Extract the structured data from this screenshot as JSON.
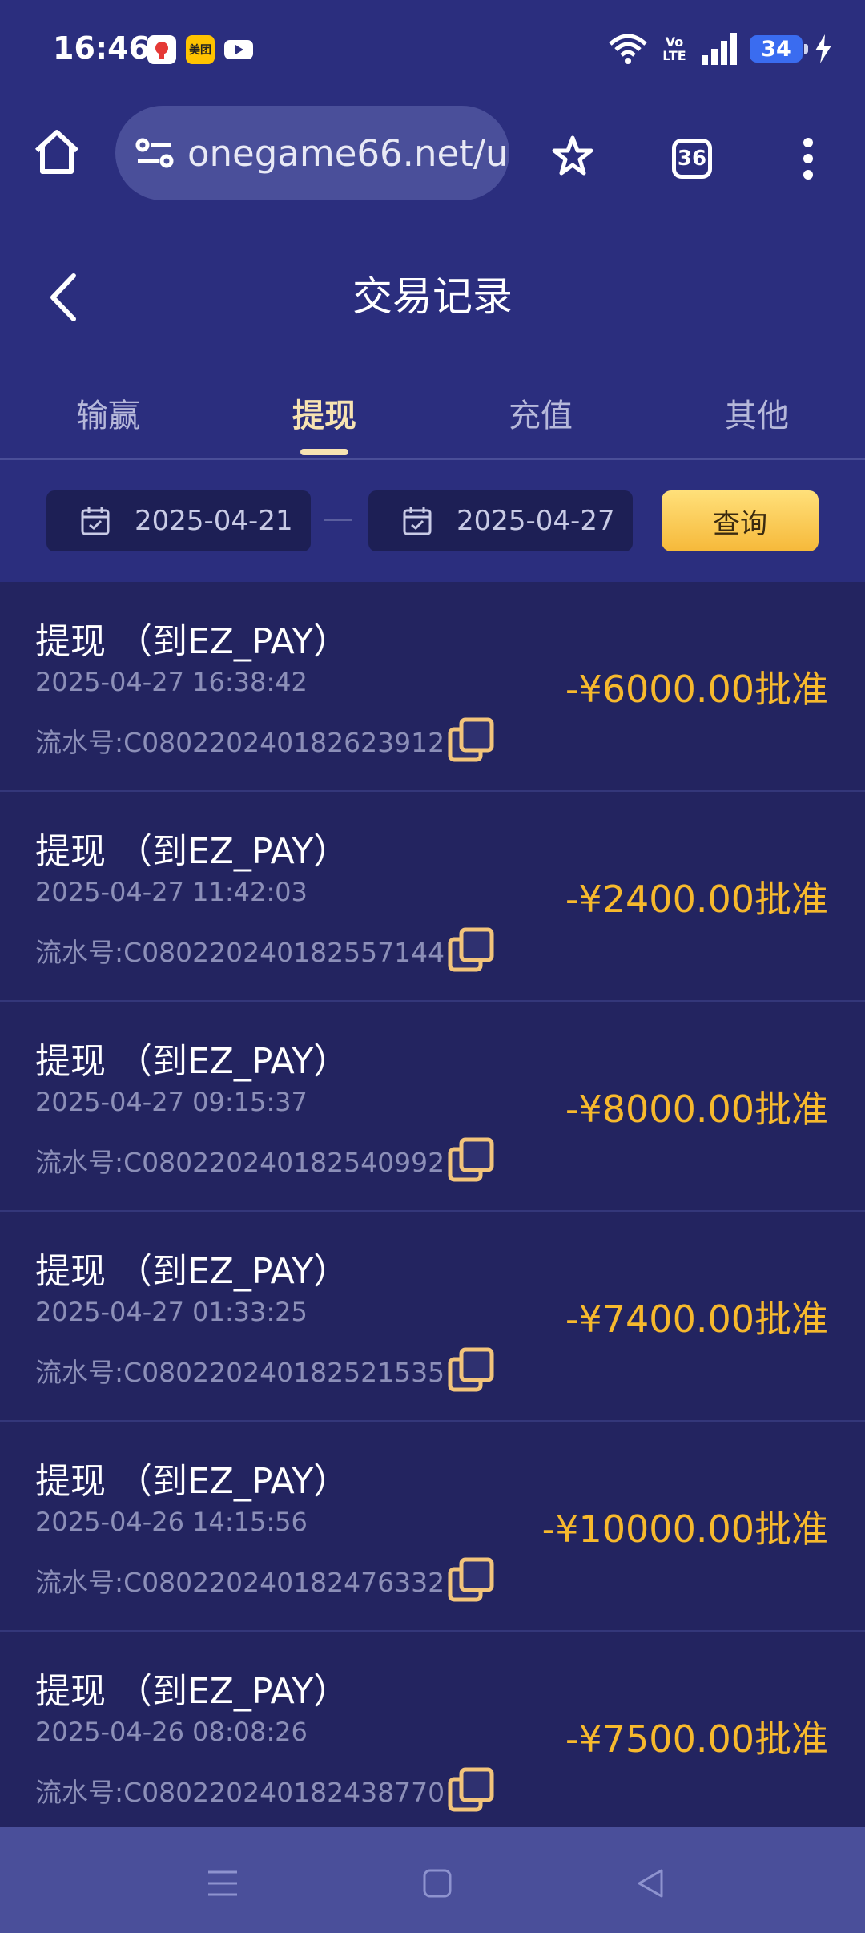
{
  "status_bar": {
    "time": "16:46",
    "notification_icons": [
      {
        "name": "app-icon",
        "label": "",
        "color": "#ffffff"
      },
      {
        "name": "meituan-icon",
        "label": "美团",
        "color": "#ffc300"
      },
      {
        "name": "youtube-icon",
        "label": "",
        "color": "#ffffff"
      }
    ],
    "network_label": "Vo LTE",
    "battery": "34"
  },
  "browser": {
    "url": "onegame66.net/u",
    "tab_count": "36"
  },
  "page": {
    "title": "交易记录",
    "tabs": [
      {
        "label": "输赢",
        "active": false
      },
      {
        "label": "提现",
        "active": true
      },
      {
        "label": "充值",
        "active": false
      },
      {
        "label": "其他",
        "active": false
      }
    ],
    "filter": {
      "start_date": "2025-04-21",
      "end_date": "2025-04-27",
      "query_label": "查询"
    },
    "records": [
      {
        "title": "提现 （到EZ_PAY）",
        "time": "2025-04-27 16:38:42",
        "serial": "流水号:C080220240182623912",
        "amount": "-¥6000.00批准"
      },
      {
        "title": "提现 （到EZ_PAY）",
        "time": "2025-04-27 11:42:03",
        "serial": "流水号:C080220240182557144",
        "amount": "-¥2400.00批准"
      },
      {
        "title": "提现 （到EZ_PAY）",
        "time": "2025-04-27 09:15:37",
        "serial": "流水号:C080220240182540992",
        "amount": "-¥8000.00批准"
      },
      {
        "title": "提现 （到EZ_PAY）",
        "time": "2025-04-27 01:33:25",
        "serial": "流水号:C080220240182521535",
        "amount": "-¥7400.00批准"
      },
      {
        "title": "提现 （到EZ_PAY）",
        "time": "2025-04-26 14:15:56",
        "serial": "流水号:C080220240182476332",
        "amount": "-¥10000.00批准"
      },
      {
        "title": "提现 （到EZ_PAY）",
        "time": "2025-04-26 08:08:26",
        "serial": "流水号:C080220240182438770",
        "amount": "-¥7500.00批准"
      }
    ]
  },
  "colors": {
    "accent": "#f7b92d",
    "header_bg": "#2b2e7e",
    "list_bg": "#232460"
  }
}
